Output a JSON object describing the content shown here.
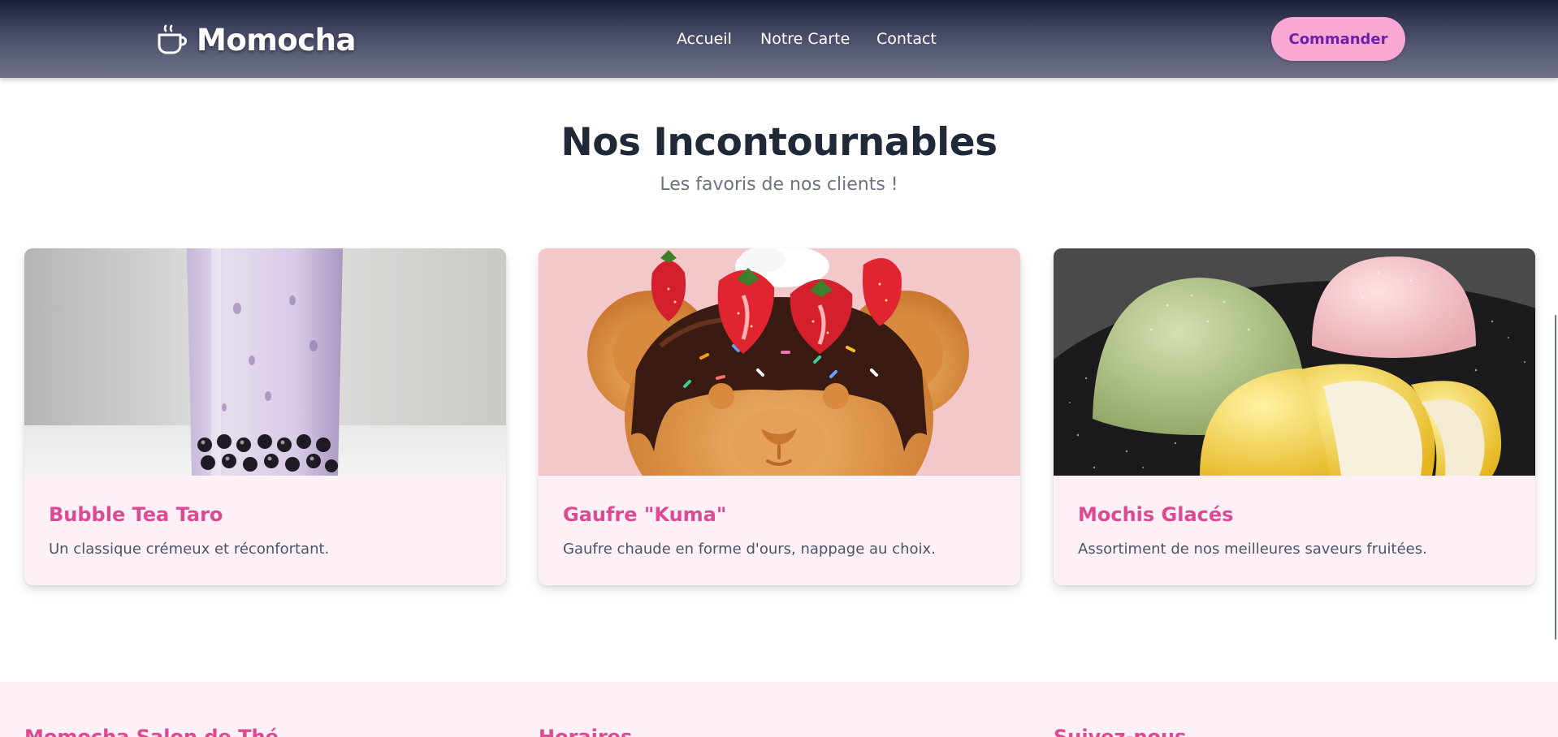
{
  "header": {
    "brand_name": "Momocha",
    "brand_icon": "coffee-cup-icon",
    "nav": [
      "Accueil",
      "Notre Carte",
      "Contact"
    ],
    "cta_label": "Commander"
  },
  "section": {
    "title": "Nos Incontournables",
    "subtitle": "Les favoris de nos clients !"
  },
  "cards": [
    {
      "title": "Bubble Tea Taro",
      "description": "Un classique crémeux et réconfortant."
    },
    {
      "title": "Gaufre \"Kuma\"",
      "description": "Gaufre chaude en forme d'ours, nappage au choix."
    },
    {
      "title": "Mochis Glacés",
      "description": "Assortiment de nos meilleures saveurs fruitées."
    }
  ],
  "footer": {
    "headings": [
      "Momocha Salon de Thé",
      "Horaires",
      "Suivez-nous"
    ]
  },
  "colors": {
    "accent_pink": "#db4a93",
    "button_pink": "#f9a8d4",
    "button_text": "#6b21a8",
    "card_bg": "#fdf0f7"
  }
}
